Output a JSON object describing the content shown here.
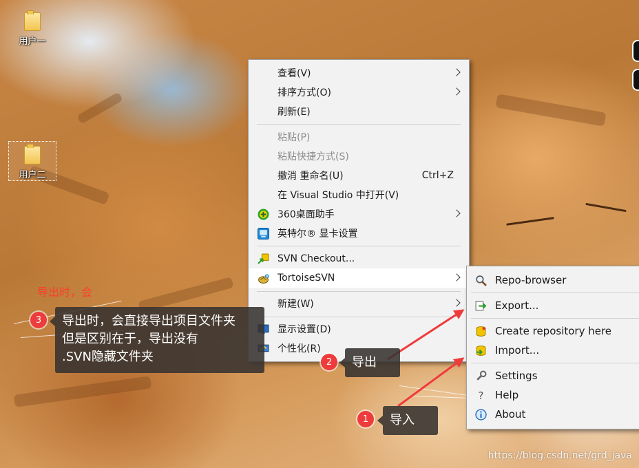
{
  "desktop": {
    "icons": [
      {
        "label": "用户一"
      },
      {
        "label": "用户二"
      }
    ]
  },
  "context_menu": {
    "items": {
      "view": "查看(V)",
      "sort": "排序方式(O)",
      "refresh": "刷新(E)",
      "paste": "粘贴(P)",
      "paste_shortcut": "粘贴快捷方式(S)",
      "undo": "撤消 重命名(U)",
      "undo_shortcut": "Ctrl+Z",
      "open_vs": "在 Visual Studio 中打开(V)",
      "assistant_360": "360桌面助手",
      "intel_graphics": "英特尔® 显卡设置",
      "svn_checkout": "SVN Checkout...",
      "tortoise_svn": "TortoiseSVN",
      "new": "新建(W)",
      "display_settings": "显示设置(D)",
      "personalize": "个性化(R)"
    }
  },
  "tortoise_submenu": {
    "items": {
      "repo_browser": "Repo-browser",
      "export": "Export...",
      "create_repo": "Create repository here",
      "import": "Import...",
      "settings": "Settings",
      "help": "Help",
      "about": "About"
    }
  },
  "annotations": {
    "note1": {
      "number": "1",
      "text": "导入"
    },
    "note2": {
      "number": "2",
      "text": "导出"
    },
    "note3": {
      "number": "3",
      "line1": "导出时，会直接导出项目文件夹",
      "line2": "但是区别在于，导出没有",
      "line3": ".SVN隐藏文件夹"
    },
    "faded_text": "导出时，会",
    "colors": {
      "badge": "#ee3b3b",
      "arrow": "#ee3b3b",
      "box": "#373230"
    }
  },
  "watermark": "https://blog.csdn.net/grd_java"
}
